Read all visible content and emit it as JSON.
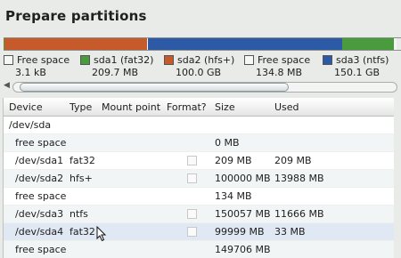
{
  "title": "Prepare partitions",
  "partition_bar": {
    "segments": [
      {
        "name": "free-space-1",
        "color": "#f4f4f4",
        "share": 0.001
      },
      {
        "name": "sda1",
        "color": "#4a9a3e",
        "share": 0.001
      },
      {
        "name": "sda2",
        "color": "#c65a2a",
        "share": 0.36
      },
      {
        "name": "free-space-2",
        "color": "#f4f4f4",
        "share": 0.001
      },
      {
        "name": "sda3",
        "color": "#2c5aa6",
        "share": 0.49
      },
      {
        "name": "sda4",
        "color": "#4a9a3e",
        "share": 0.13
      },
      {
        "name": "free-space-3",
        "color": "#f4f4f4",
        "share": 0.005
      }
    ]
  },
  "legend": [
    {
      "label": "Free space",
      "size": "3.1 kB",
      "color": "#f7f7f7"
    },
    {
      "label": "sda1 (fat32)",
      "size": "209.7 MB",
      "color": "#4a9a3e"
    },
    {
      "label": "sda2 (hfs+)",
      "size": "100.0 GB",
      "color": "#c65a2a"
    },
    {
      "label": "Free space",
      "size": "134.8 MB",
      "color": "#f7f7f7"
    },
    {
      "label": "sda3 (ntfs)",
      "size": "150.1 GB",
      "color": "#2c5aa6"
    }
  ],
  "table": {
    "headers": {
      "device": "Device",
      "type": "Type",
      "mount": "Mount point",
      "format": "Format?",
      "size": "Size",
      "used": "Used"
    },
    "rows": [
      {
        "device": "/dev/sda",
        "type": "",
        "mount": "",
        "format": false,
        "size": "",
        "used": "",
        "checkbox": false
      },
      {
        "device": "free space",
        "type": "",
        "mount": "",
        "format": false,
        "size": "0 MB",
        "used": "",
        "checkbox": false
      },
      {
        "device": "/dev/sda1",
        "type": "fat32",
        "mount": "",
        "format": false,
        "size": "209 MB",
        "used": "209 MB",
        "checkbox": true
      },
      {
        "device": "/dev/sda2",
        "type": "hfs+",
        "mount": "",
        "format": false,
        "size": "100000 MB",
        "used": "13988 MB",
        "checkbox": true
      },
      {
        "device": "free space",
        "type": "",
        "mount": "",
        "format": false,
        "size": "134 MB",
        "used": "",
        "checkbox": false
      },
      {
        "device": "/dev/sda3",
        "type": "ntfs",
        "mount": "",
        "format": false,
        "size": "150057 MB",
        "used": "11666 MB",
        "checkbox": true
      },
      {
        "device": "/dev/sda4",
        "type": "fat32",
        "mount": "",
        "format": false,
        "size": "99999 MB",
        "used": "33 MB",
        "checkbox": true
      },
      {
        "device": "free space",
        "type": "",
        "mount": "",
        "format": false,
        "size": "149706 MB",
        "used": "",
        "checkbox": false
      }
    ]
  },
  "scroll_left_icon": "scroll-left-arrow-icon",
  "colors": {
    "selected_row": "#dfe8f3",
    "alt_row": "#f2f5f6"
  }
}
